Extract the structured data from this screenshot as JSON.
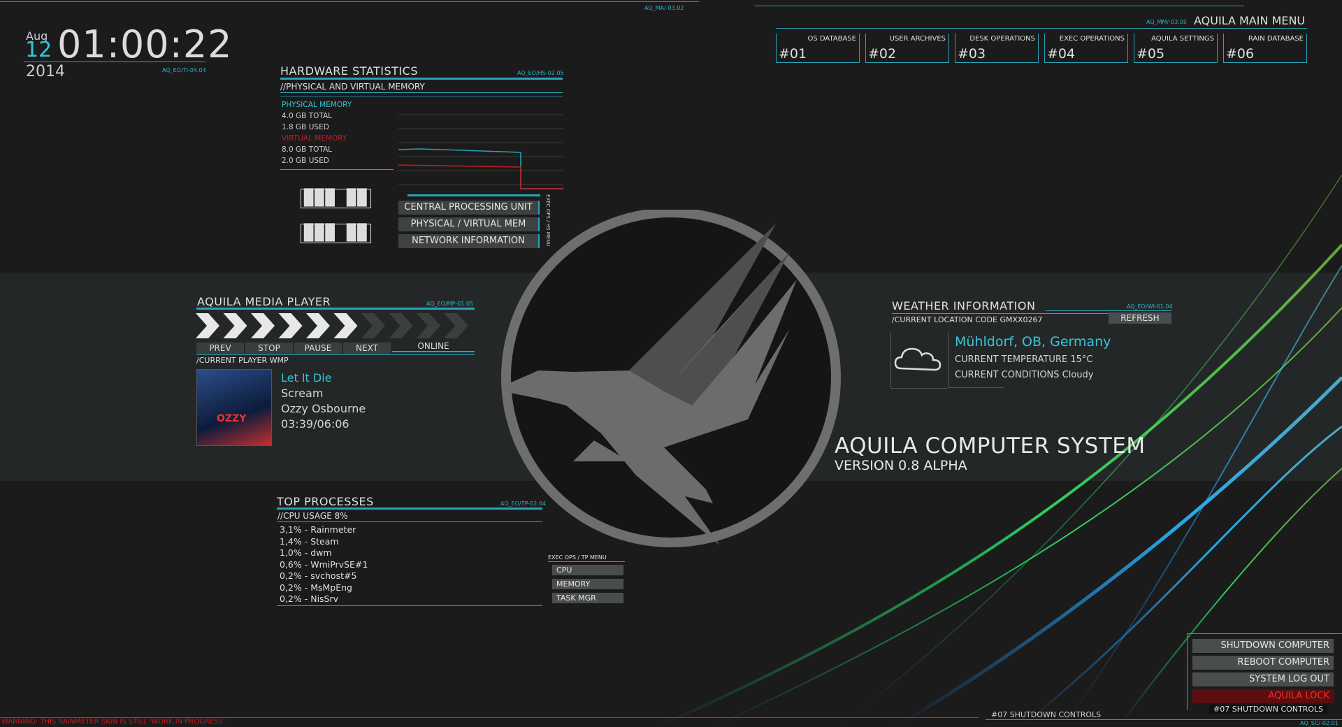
{
  "clock": {
    "month": "Aug",
    "day": "12",
    "time": "01:00:22",
    "year": "2014",
    "code": "AQ_EO/TI-04.04"
  },
  "top_codes": {
    "left": "AQ_MA/-03.02",
    "menu": "AQ_MM/-03.05"
  },
  "main_menu": {
    "title": "AQUILA MAIN MENU",
    "items": [
      {
        "label": "OS DATABASE",
        "num": "#01"
      },
      {
        "label": "USER ARCHIVES",
        "num": "#02"
      },
      {
        "label": "DESK OPERATIONS",
        "num": "#03"
      },
      {
        "label": "EXEC OPERATIONS",
        "num": "#04"
      },
      {
        "label": "AQUILA SETTINGS",
        "num": "#05"
      },
      {
        "label": "RAIN DATABASE",
        "num": "#06"
      }
    ]
  },
  "hardware": {
    "title": "HARDWARE STATISTICS",
    "code": "AQ_EO/HS-02.05",
    "subtitle": "//PHYSICAL AND VIRTUAL MEMORY",
    "physical_label": "PHYSICAL MEMORY",
    "physical_total": "4.0 GB TOTAL",
    "physical_used": "1.8 GB USED",
    "virtual_label": "VIRTUAL MEMORY",
    "virtual_total": "8.0 GB TOTAL",
    "virtual_used": "2.0 GB USED",
    "buttons": [
      "CENTRAL PROCESSING UNIT",
      "PHYSICAL / VIRTUAL MEM",
      "NETWORK INFORMATION"
    ],
    "side_label": "EXEC OPS / HS MENU",
    "colors": {
      "physical": "#35c6d8",
      "virtual": "#c81c1c"
    }
  },
  "media": {
    "title": "AQUILA MEDIA PLAYER",
    "code": "AQ_EO/MP-01.05",
    "progress_chevrons_lit": 6,
    "progress_chevrons_total": 10,
    "buttons": [
      "PREV",
      "STOP",
      "PAUSE",
      "NEXT"
    ],
    "status": "ONLINE",
    "player": "/CURRENT PLAYER WMP",
    "track": "Let It Die",
    "album": "Scream",
    "artist": "Ozzy Osbourne",
    "position": "03:39/06:06"
  },
  "processes": {
    "title": "TOP PROCESSES",
    "code": "AQ_EO/TP-02.04",
    "cpu": "//CPU USAGE 8%",
    "list": [
      "3,1% - Rainmeter",
      "1,4% - Steam",
      "1,0% - dwm",
      "0,6% - WmiPrvSE#1",
      "0,2% - svchost#5",
      "0,2% - MsMpEng",
      "0,2% - NisSrv"
    ],
    "menu_label": "EXEC OPS / TP MENU",
    "menu": [
      "CPU",
      "MEMORY",
      "TASK MGR"
    ]
  },
  "weather": {
    "title": "WEATHER INFORMATION",
    "code": "AQ_EO/WI-01.04",
    "location_code": "/CURRENT LOCATION CODE GMXX0267",
    "refresh": "REFRESH",
    "city": "Mühldorf, OB, Germany",
    "temperature": "CURRENT TEMPERATURE 15°C",
    "conditions": "CURRENT CONDITIONS Cloudy",
    "icon": "cloud-icon"
  },
  "system": {
    "name": "AQUILA COMPUTER SYSTEM",
    "version": "VERSION 0.8 ALPHA"
  },
  "shutdown": {
    "buttons": [
      "SHUTDOWN COMPUTER",
      "REBOOT COMPUTER",
      "SYSTEM LOG OUT",
      "AQUILA LOCK"
    ],
    "footer": "#07 SHUTDOWN CONTROLS",
    "bar_label": "#07 SHUTDOWN CONTROLS",
    "code": "AQ_SC/-02.01"
  },
  "warning": "WARNING: THIS RAINMETER SKIN IS STILL 'WORK IN PROGRESS'"
}
